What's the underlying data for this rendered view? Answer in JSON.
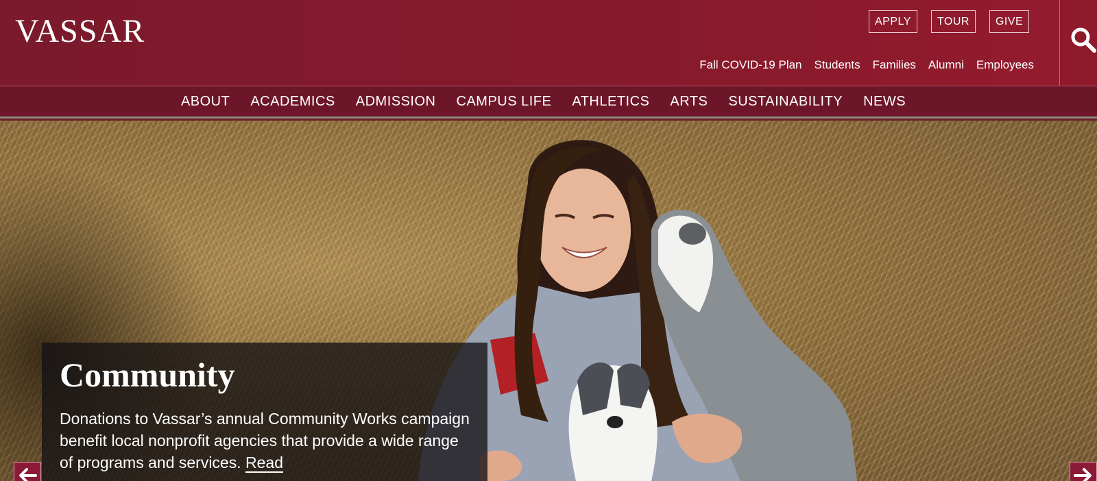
{
  "brand": {
    "logo_text": "VASSAR"
  },
  "utility": {
    "buttons": [
      "APPLY",
      "TOUR",
      "GIVE"
    ],
    "audience_links": [
      "Fall COVID-19 Plan",
      "Students",
      "Families",
      "Alumni",
      "Employees"
    ]
  },
  "search": {
    "icon": "search-icon"
  },
  "nav": {
    "items": [
      "ABOUT",
      "ACADEMICS",
      "ADMISSION",
      "CAMPUS LIFE",
      "ATHLETICS",
      "ARTS",
      "SUSTAINABILITY",
      "NEWS"
    ]
  },
  "hero": {
    "caption_title": "Community",
    "caption_text": "Donations to Vassar’s annual Community Works campaign benefit local nonprofit agencies that provide a wide range of programs and services.",
    "read_link": "Read",
    "prev_icon": "arrow-left-icon",
    "next_icon": "arrow-right-icon"
  },
  "colors": {
    "brand_maroon": "#861a2c",
    "nav_maroon": "#6d1629",
    "arrow_maroon": "#8a1a35"
  }
}
